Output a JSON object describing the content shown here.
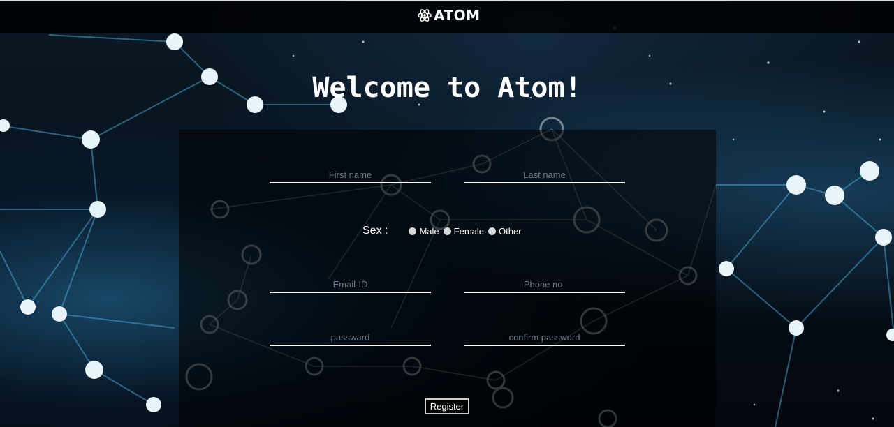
{
  "header": {
    "brand_name": "ATOM",
    "brand_icon": "atom-icon"
  },
  "main": {
    "welcome_title": "Welcome to Atom!"
  },
  "form": {
    "first_name": {
      "placeholder": "First name",
      "value": ""
    },
    "last_name": {
      "placeholder": "Last name",
      "value": ""
    },
    "sex": {
      "label": "Sex :",
      "options": [
        "Male",
        "Female",
        "Other"
      ]
    },
    "email": {
      "placeholder": "Email-ID",
      "value": ""
    },
    "phone": {
      "placeholder": "Phone no.",
      "value": ""
    },
    "password": {
      "placeholder": "passward",
      "value": ""
    },
    "confirm_password": {
      "placeholder": "confirm password",
      "value": ""
    },
    "register_label": "Register"
  },
  "colors": {
    "accent_line": "#ffffff",
    "panel": "rgba(0,0,0,0.55)",
    "topbar": "#000000"
  }
}
